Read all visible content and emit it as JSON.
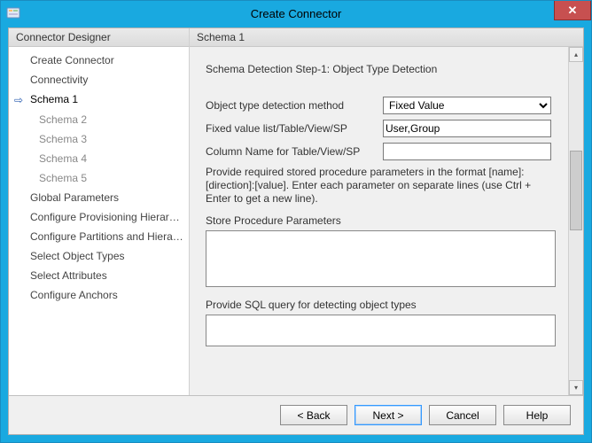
{
  "window": {
    "title": "Create Connector"
  },
  "left": {
    "header": "Connector Designer",
    "items": [
      {
        "label": "Create Connector",
        "active": false,
        "sub": false
      },
      {
        "label": "Connectivity",
        "active": false,
        "sub": false
      },
      {
        "label": "Schema 1",
        "active": true,
        "sub": false
      },
      {
        "label": "Schema 2",
        "active": false,
        "sub": true
      },
      {
        "label": "Schema 3",
        "active": false,
        "sub": true
      },
      {
        "label": "Schema 4",
        "active": false,
        "sub": true
      },
      {
        "label": "Schema 5",
        "active": false,
        "sub": true
      },
      {
        "label": "Global Parameters",
        "active": false,
        "sub": false
      },
      {
        "label": "Configure Provisioning Hierarchy",
        "active": false,
        "sub": false
      },
      {
        "label": "Configure Partitions and Hierarchies",
        "active": false,
        "sub": false
      },
      {
        "label": "Select Object Types",
        "active": false,
        "sub": false
      },
      {
        "label": "Select Attributes",
        "active": false,
        "sub": false
      },
      {
        "label": "Configure Anchors",
        "active": false,
        "sub": false
      }
    ]
  },
  "right": {
    "header": "Schema 1",
    "step_title": "Schema Detection Step-1: Object Type Detection",
    "labels": {
      "method": "Object type detection method",
      "fixed_list": "Fixed value list/Table/View/SP",
      "column_name": "Column Name for Table/View/SP",
      "sp_params": "Store Procedure Parameters",
      "sql_query": "Provide SQL query for detecting object types"
    },
    "values": {
      "method": "Fixed Value",
      "fixed_list": "User,Group",
      "column_name": "",
      "sp_params": "",
      "sql_query": ""
    },
    "help_text": "Provide required stored procedure parameters in the format [name]:[direction]:[value]. Enter each parameter on separate lines (use Ctrl + Enter to get a new line)."
  },
  "buttons": {
    "back": "<  Back",
    "next": "Next  >",
    "cancel": "Cancel",
    "help": "Help"
  }
}
